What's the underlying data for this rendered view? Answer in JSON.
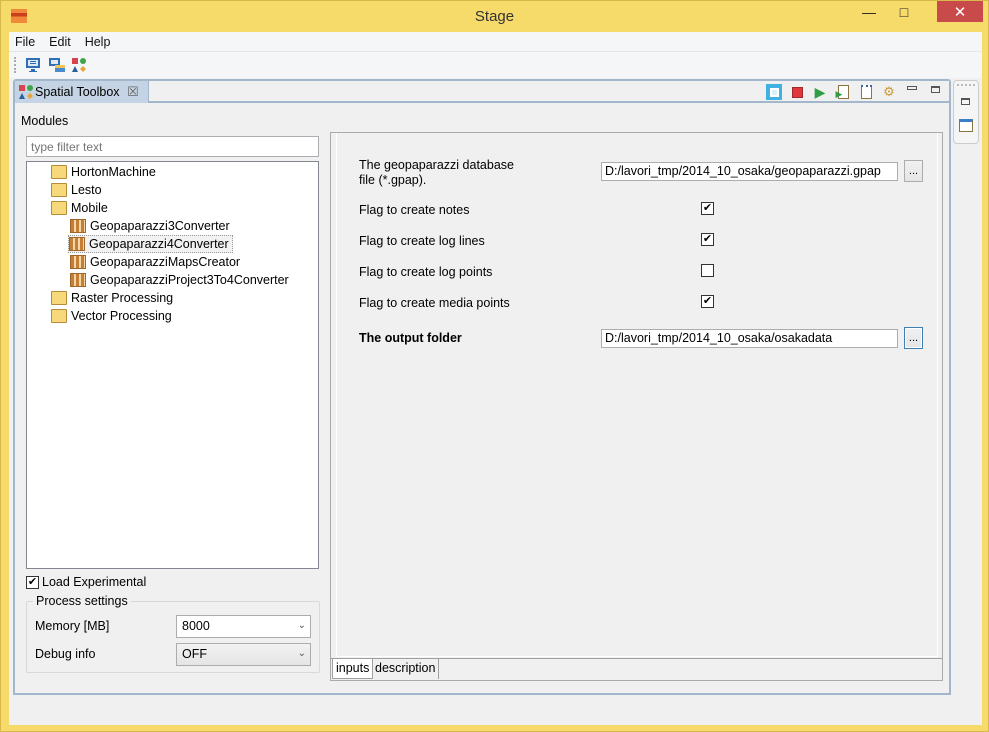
{
  "window": {
    "title": "Stage",
    "minimize_icon": "minimize-icon",
    "maximize_icon": "maximize-icon",
    "close_icon": "close-icon",
    "minimize_glyph": "—",
    "maximize_glyph": "□",
    "close_glyph": "✕"
  },
  "menu": {
    "items": [
      "File",
      "Edit",
      "Help"
    ]
  },
  "toolbar": {
    "icons": [
      "monitor-icon",
      "monitor-folder-icon",
      "spatial-toolbox-icon"
    ]
  },
  "view": {
    "tab_label": "Spatial Toolbox",
    "tab_close_glyph": "☒",
    "actions": [
      {
        "name": "select-mode-icon",
        "glyph": "□"
      },
      {
        "name": "stop-icon",
        "glyph": "■"
      },
      {
        "name": "run-icon",
        "glyph": "▶"
      },
      {
        "name": "generate-script-icon",
        "glyph": "▷"
      },
      {
        "name": "new-script-icon",
        "glyph": "▯"
      },
      {
        "name": "settings-icon",
        "glyph": "⚙"
      },
      {
        "name": "minimize-view-icon",
        "glyph": "▁"
      },
      {
        "name": "maximize-view-icon",
        "glyph": "❐"
      }
    ]
  },
  "left": {
    "modules_label": "Modules",
    "filter_placeholder": "type filter text",
    "tree": [
      {
        "label": "HortonMachine",
        "type": "folder",
        "level": 0
      },
      {
        "label": "Lesto",
        "type": "folder",
        "level": 0
      },
      {
        "label": "Mobile",
        "type": "folder",
        "level": 0
      },
      {
        "label": "Geopaparazzi3Converter",
        "type": "module",
        "level": 1
      },
      {
        "label": "Geopaparazzi4Converter",
        "type": "module",
        "level": 1,
        "selected": true
      },
      {
        "label": "GeopaparazziMapsCreator",
        "type": "module",
        "level": 1
      },
      {
        "label": "GeopaparazziProject3To4Converter",
        "type": "module",
        "level": 1
      },
      {
        "label": "Raster Processing",
        "type": "folder",
        "level": 0
      },
      {
        "label": "Vector Processing",
        "type": "folder",
        "level": 0
      }
    ],
    "load_experimental": {
      "label": "Load Experimental",
      "checked": true
    },
    "process_settings": {
      "legend": "Process settings",
      "memory_label": "Memory [MB]",
      "memory_value": "8000",
      "debug_label": "Debug info",
      "debug_value": "OFF"
    }
  },
  "params": {
    "db_file_label_line1": "The geopaparazzi database",
    "db_file_label_line2": "file (*.gpap).",
    "db_file_value": "D:/lavori_tmp/2014_10_osaka/geopaparazzi.gpap",
    "browse_label": "...",
    "flags": [
      {
        "label": "Flag to create notes",
        "checked": true
      },
      {
        "label": "Flag to create log lines",
        "checked": true
      },
      {
        "label": "Flag to create log points",
        "checked": false
      },
      {
        "label": "Flag to create media points",
        "checked": true
      }
    ],
    "output_label": "The output folder",
    "output_value": "D:/lavori_tmp/2014_10_osaka/osakadata"
  },
  "bottom_tabs": [
    "inputs",
    "description"
  ]
}
